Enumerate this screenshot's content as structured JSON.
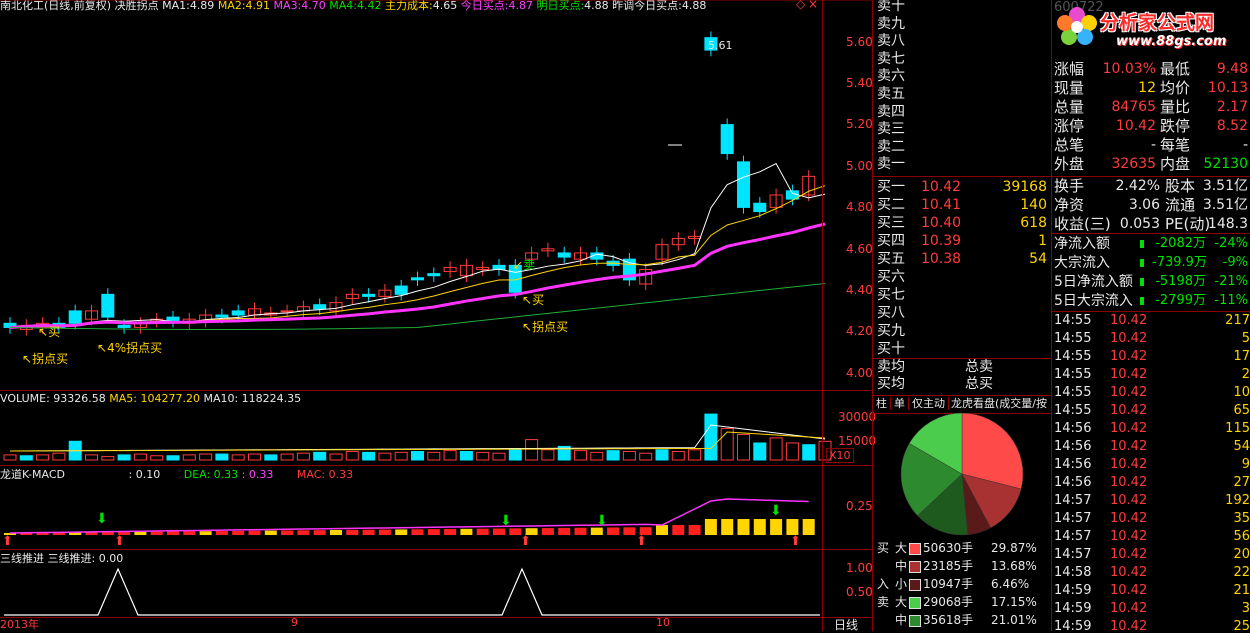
{
  "header": {
    "name": "南北化工(日线,前复权) 决胜拐点",
    "ma1_label": "MA1:",
    "ma1": "4.89",
    "ma2_label": "MA2:",
    "ma2": "4.91",
    "ma3_label": "MA3:",
    "ma3": "4.70",
    "ma4_label": "MA4:",
    "ma4": "4.42",
    "cost_label": "主力成本:",
    "cost": "4.65",
    "today_label": "今日买点:",
    "today": "4.87",
    "tomorrow_label": "明日买点:",
    "tomorrow": "4.88",
    "yesterday_label": "昨调今日买点:",
    "yesterday": "4.88"
  },
  "price_axis": [
    "5.60",
    "5.40",
    "5.20",
    "5.00",
    "4.80",
    "4.60",
    "4.40",
    "4.20",
    "4.00"
  ],
  "annotations": {
    "high": "5.61",
    "sell": "卖",
    "buy1": "买",
    "buy2": "买",
    "turn1": "拐点买",
    "turn2": "4%拐点买",
    "turn3": "拐点买"
  },
  "volume": {
    "label": "VOLUME: 93326.58",
    "ma5": "MA5: 104277.20",
    "ma10": "MA10: 118224.35",
    "axis": [
      "30000",
      "15000"
    ],
    "unit": "X10"
  },
  "macd": {
    "label": "龙道K-MACD",
    "val": ": 0.10",
    "dea": "DEA: 0.33",
    "dea2": ": 0.33",
    "mac": "MAC: 0.33",
    "axis": [
      "0.25"
    ]
  },
  "tri": {
    "label": "三线推进  三线推进: 0.00",
    "axis": [
      "1.00",
      "0.50"
    ]
  },
  "date_axis": [
    "2013年",
    "9",
    "10"
  ],
  "period": "日线",
  "logo": {
    "name": "分析家公式网",
    "url": "www.88gs.com"
  },
  "sell_levels": [
    "卖十",
    "卖九",
    "卖八",
    "卖七",
    "卖六",
    "卖五",
    "卖四",
    "卖三",
    "卖二",
    "卖一"
  ],
  "buy_levels": [
    {
      "label": "买一",
      "price": "10.42",
      "vol": "39168"
    },
    {
      "label": "买二",
      "price": "10.41",
      "vol": "140"
    },
    {
      "label": "买三",
      "price": "10.40",
      "vol": "618"
    },
    {
      "label": "买四",
      "price": "10.39",
      "vol": "1"
    },
    {
      "label": "买五",
      "price": "10.38",
      "vol": "54"
    },
    {
      "label": "买六",
      "price": "",
      "vol": ""
    },
    {
      "label": "买七",
      "price": "",
      "vol": ""
    },
    {
      "label": "买八",
      "price": "",
      "vol": ""
    },
    {
      "label": "买九",
      "price": "",
      "vol": ""
    },
    {
      "label": "买十",
      "price": "",
      "vol": ""
    }
  ],
  "avg": {
    "sell_avg": "卖均",
    "total_sell": "总卖",
    "buy_avg": "买均",
    "total_buy": "总买"
  },
  "tabs": [
    "柱",
    "单",
    "仅主动",
    "龙虎看盘(成交量/按"
  ],
  "pie": {
    "slices": [
      {
        "name": "buy-large",
        "value": 29.87,
        "color": "#ff4a4a"
      },
      {
        "name": "buy-mid",
        "value": 13.68,
        "color": "#a83232"
      },
      {
        "name": "buy-small",
        "value": 6.46,
        "color": "#5a1a1a"
      },
      {
        "name": "sell-small",
        "value": 15.0,
        "color": "#1e5a1e"
      },
      {
        "name": "sell-mid",
        "value": 21.01,
        "color": "#2e8a2e"
      },
      {
        "name": "sell-large",
        "value": 17.15,
        "color": "#4ccc4c"
      }
    ]
  },
  "flow_rows": [
    {
      "side": "买",
      "size": "大",
      "vol": "50630手",
      "pct": "29.87%",
      "color": "#ff4a4a"
    },
    {
      "side": "",
      "size": "中",
      "vol": "23185手",
      "pct": "13.68%",
      "color": "#a83232"
    },
    {
      "side": "入",
      "size": "小",
      "vol": "10947手",
      "pct": "6.46%",
      "color": "#5a1a1a"
    },
    {
      "side": "卖",
      "size": "大",
      "vol": "29068手",
      "pct": "17.15%",
      "color": "#4ccc4c"
    },
    {
      "side": "",
      "size": "中",
      "vol": "35618手",
      "pct": "21.01%",
      "color": "#2e8a2e"
    }
  ],
  "quote": {
    "code": "600722",
    "rows": [
      {
        "k1": "涨幅",
        "v1": "10.03%",
        "k2": "最低",
        "v2": "9.48"
      },
      {
        "k1": "现量",
        "v1": "12",
        "k2": "均价",
        "v2": "10.13"
      },
      {
        "k1": "总量",
        "v1": "84765",
        "k2": "量比",
        "v2": "2.17"
      },
      {
        "k1": "涨停",
        "v1": "10.42",
        "k2": "跌停",
        "v2": "8.52"
      },
      {
        "k1": "总笔",
        "v1": "-",
        "k2": "每笔",
        "v2": "-"
      },
      {
        "k1": "外盘",
        "v1": "32635",
        "k2": "内盘",
        "v2": "52130"
      }
    ],
    "rows2": [
      {
        "k1": "换手",
        "v1": "2.42%",
        "k2": "股本",
        "v2": "3.51亿"
      },
      {
        "k1": "净资",
        "v1": "3.06",
        "k2": "流通",
        "v2": "3.51亿"
      },
      {
        "k1": "收益(三)",
        "v1": "0.053",
        "k2": "PE(动)",
        "v2": "148.3"
      }
    ],
    "flows": [
      {
        "k": "净流入额",
        "v": "-2082万",
        "p": "-24%"
      },
      {
        "k": "大宗流入",
        "v": "-739.9万",
        "p": "-9%"
      },
      {
        "k": "5日净流入额",
        "v": "-5198万",
        "p": "-21%"
      },
      {
        "k": "5日大宗流入",
        "v": "-2799万",
        "p": "-11%"
      }
    ]
  },
  "ticks": [
    {
      "t": "14:55",
      "p": "10.42",
      "v": "217",
      "s": "S"
    },
    {
      "t": "14:55",
      "p": "10.42",
      "v": "5",
      "s": "S"
    },
    {
      "t": "14:55",
      "p": "10.42",
      "v": "17",
      "s": "S"
    },
    {
      "t": "14:55",
      "p": "10.42",
      "v": "2",
      "s": "S"
    },
    {
      "t": "14:55",
      "p": "10.42",
      "v": "10",
      "s": "S"
    },
    {
      "t": "14:55",
      "p": "10.42",
      "v": "65",
      "s": "S"
    },
    {
      "t": "14:56",
      "p": "10.42",
      "v": "115",
      "s": "S"
    },
    {
      "t": "14:56",
      "p": "10.42",
      "v": "54",
      "s": "S"
    },
    {
      "t": "14:56",
      "p": "10.42",
      "v": "9",
      "s": "S"
    },
    {
      "t": "14:56",
      "p": "10.42",
      "v": "27",
      "s": "S"
    },
    {
      "t": "14:57",
      "p": "10.42",
      "v": "192",
      "s": "S"
    },
    {
      "t": "14:57",
      "p": "10.42",
      "v": "35",
      "s": "S"
    },
    {
      "t": "14:57",
      "p": "10.42",
      "v": "56",
      "s": "S"
    },
    {
      "t": "14:57",
      "p": "10.42",
      "v": "20",
      "s": "S"
    },
    {
      "t": "14:58",
      "p": "10.42",
      "v": "22",
      "s": "S"
    },
    {
      "t": "14:59",
      "p": "10.42",
      "v": "21",
      "s": "S"
    },
    {
      "t": "14:59",
      "p": "10.42",
      "v": "3",
      "s": "S"
    },
    {
      "t": "14:59",
      "p": "10.42",
      "v": "25",
      "s": "S"
    }
  ],
  "colors": {
    "up": "#ff3b3b",
    "down": "#00e5ff",
    "ma_pink": "#ff33ff",
    "ma_green": "#1fae3a",
    "border": "#8b0000"
  }
}
